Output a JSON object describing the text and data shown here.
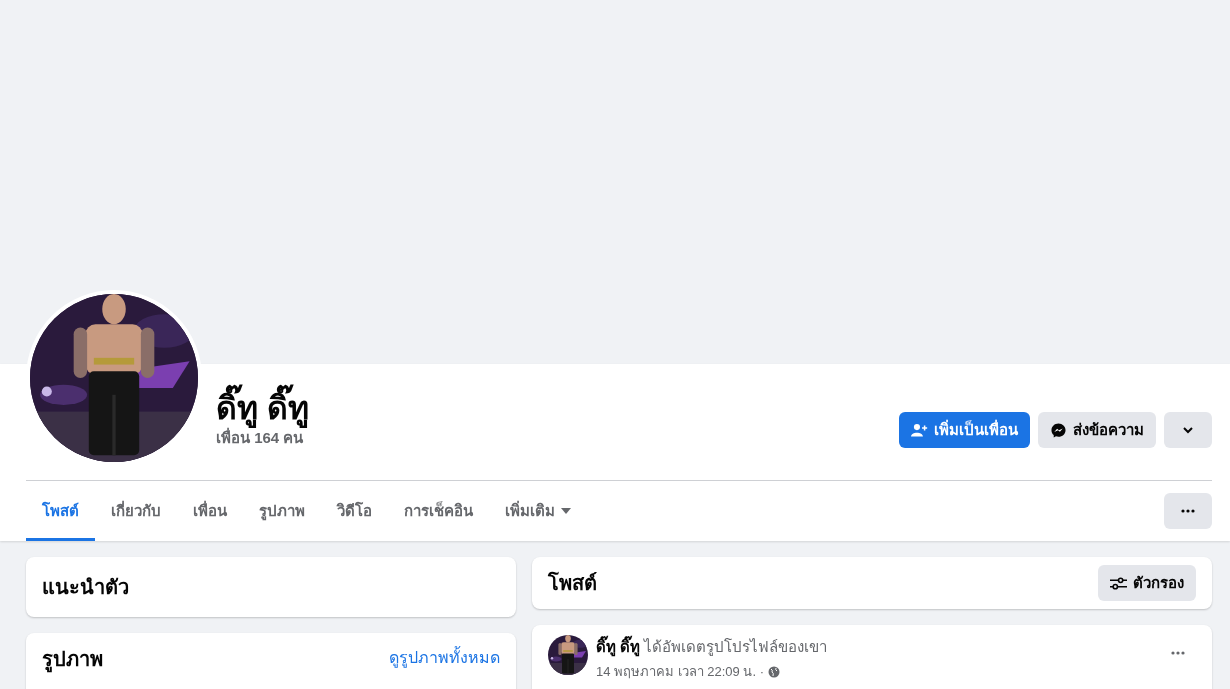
{
  "profile": {
    "name": "ดิ๊ทู ดิ๊ทู",
    "friends": "เพื่อน 164 คน"
  },
  "actions": [
    {
      "kind": "add-friend",
      "label": "เพิ่มเป็นเพื่อน"
    },
    {
      "kind": "message",
      "label": "ส่งข้อความ"
    },
    {
      "kind": "dropdown"
    }
  ],
  "tabs": [
    {
      "kind": "tab",
      "label": "โพสต์",
      "selected": true
    },
    {
      "kind": "tab",
      "label": "เกี่ยวกับ",
      "selected": false
    },
    {
      "kind": "tab",
      "label": "เพื่อน",
      "selected": false
    },
    {
      "kind": "tab",
      "label": "รูปภาพ",
      "selected": false
    },
    {
      "kind": "tab",
      "label": "วิดีโอ",
      "selected": false
    },
    {
      "kind": "tab",
      "label": "การเช็คอิน",
      "selected": false
    },
    {
      "kind": "menu",
      "label": "เพิ่มเติม",
      "selected": false
    }
  ],
  "intro": {
    "title": "แนะนำตัว"
  },
  "photos": {
    "title": "รูปภาพ",
    "link": "ดูรูปภาพทั้งหมด"
  },
  "posts_header": {
    "title": "โพสต์",
    "filter": "ตัวกรอง"
  },
  "post": {
    "author": "ดิ๊ทู ดิ๊ทู",
    "action": "ได้อัพเดตรูปโปรไฟล์ของเขา",
    "time": "14 พฤษภาคม เวลา 22:09 น. ·"
  }
}
